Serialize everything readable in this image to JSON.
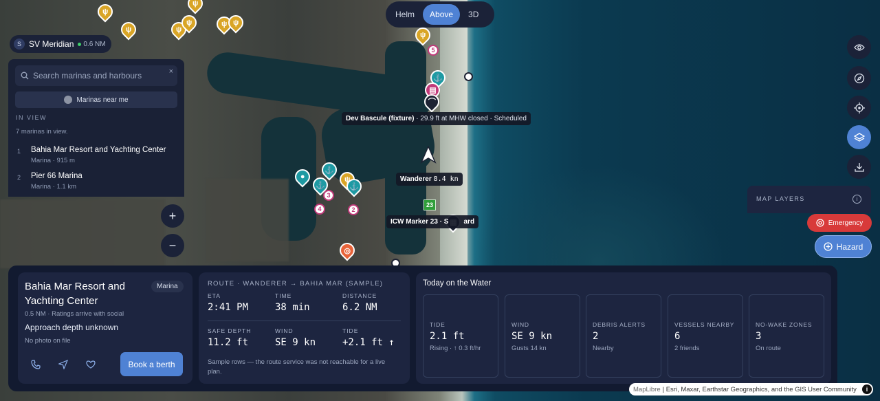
{
  "view_toggle": {
    "options": [
      "Helm",
      "Above",
      "3D"
    ],
    "selected": "Above"
  },
  "vessel": {
    "initial": "S",
    "name": "SV Meridian",
    "distance": "0.6 NM"
  },
  "search": {
    "placeholder": "Search marinas and harbours",
    "value": "",
    "clear": "×"
  },
  "near_me_label": "Marinas near me",
  "in_view": {
    "heading": "IN VIEW",
    "count_text": "7 marinas in view."
  },
  "marinas": [
    {
      "num": "1",
      "name": "Bahia Mar Resort and Yachting Center",
      "sub": "Marina · 915 m"
    },
    {
      "num": "2",
      "name": "Pier 66 Marina",
      "sub": "Marina · 1.1 km"
    }
  ],
  "zoom": {
    "in": "+",
    "out": "−"
  },
  "map_labels": {
    "bridge_title": "Dev Bascule (fixture)",
    "bridge_detail": " · 29.9 ft at MHW closed · Scheduled",
    "vessel_label": "Wanderer",
    "vessel_speed": "8.4 kn",
    "marker_label": "ICW Marker 23 · S",
    "marker_suffix": "ard",
    "marker_num": "23"
  },
  "map_badges": [
    "5",
    "4",
    "3",
    "2"
  ],
  "right_controls": {
    "icons": [
      "eye-icon",
      "compass-icon",
      "locate-icon",
      "layers-icon",
      "download-icon"
    ],
    "active": "layers-icon"
  },
  "map_layers": {
    "title": "MAP LAYERS",
    "info": "i"
  },
  "emergency_label": "Emergency",
  "hazard_label": "Hazard",
  "marina_card": {
    "name": "Bahia Mar Resort and Yachting Center",
    "tag": "Marina",
    "distance": "0.5 NM",
    "ratings": "Ratings arrive with social",
    "depth": "Approach depth unknown",
    "photo": "No photo on file",
    "book_label": "Book a berth"
  },
  "route_card": {
    "header": "ROUTE · WANDERER → BAHIA MAR (SAMPLE)",
    "cells": [
      {
        "k": "ETA",
        "v": "2:41 PM"
      },
      {
        "k": "TIME",
        "v": "38 min"
      },
      {
        "k": "DISTANCE",
        "v": "6.2 NM"
      },
      {
        "k": "SAFE DEPTH",
        "v": "11.2 ft"
      },
      {
        "k": "WIND",
        "v": "SE 9 kn"
      },
      {
        "k": "TIDE",
        "v": "+2.1 ft ↑"
      }
    ],
    "note": "Sample rows — the route service was not reachable for a live plan."
  },
  "today_card": {
    "header": "Today on the Water",
    "cells": [
      {
        "k": "TIDE",
        "v": "2.1 ft",
        "s": "Rising · ↑ 0.3 ft/hr"
      },
      {
        "k": "WIND",
        "v": "SE 9 kn",
        "s": "Gusts 14 kn"
      },
      {
        "k": "DEBRIS ALERTS",
        "v": "2",
        "s": "Nearby"
      },
      {
        "k": "VESSELS NEARBY",
        "v": "6",
        "s": "2 friends"
      },
      {
        "k": "NO-WAKE ZONES",
        "v": "3",
        "s": "On route"
      }
    ]
  },
  "attribution": {
    "maplibre": "MapLibre",
    "sources": "| Esri, Maxar, Earthstar Geographics, and the GIS User Community",
    "info": "i"
  }
}
